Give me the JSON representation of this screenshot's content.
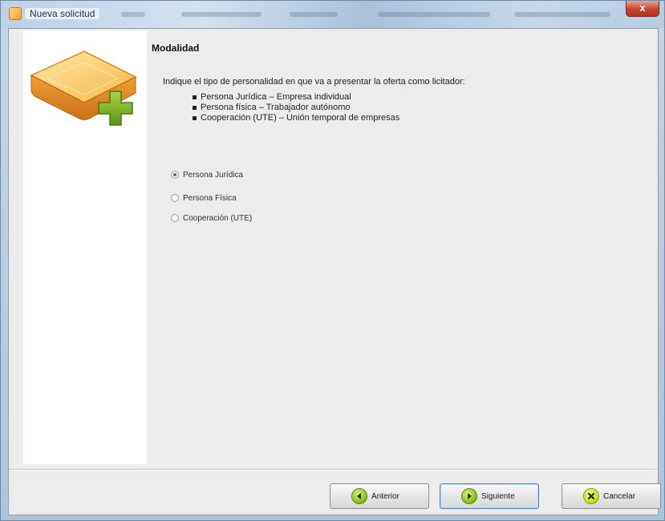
{
  "window": {
    "title": "Nueva solicitud",
    "close_glyph": "x"
  },
  "page": {
    "heading": "Modalidad",
    "intro": "Indique el tipo de personalidad en que va a presentar la oferta como licitador:",
    "bullets": [
      "Persona Jurídica – Empresa individual",
      "Persona física – Trabajador autónomo",
      "Cooperación (UTE) – Unión temporal de empresas"
    ]
  },
  "options": [
    {
      "label": "Persona Jurídica",
      "selected": true
    },
    {
      "label": "Persona Física",
      "selected": false
    },
    {
      "label": "Cooperación (UTE)",
      "selected": false
    }
  ],
  "buttons": {
    "back": "Anterior",
    "next": "Siguiente",
    "cancel": "Cancelar"
  },
  "icons": {
    "window": "folder-app-icon",
    "side": "box-add-icon",
    "back": "arrow-left-icon",
    "next": "arrow-right-icon",
    "cancel": "x-icon"
  },
  "colors": {
    "accent_green": "#7fb41a",
    "box_orange": "#f0a033"
  }
}
